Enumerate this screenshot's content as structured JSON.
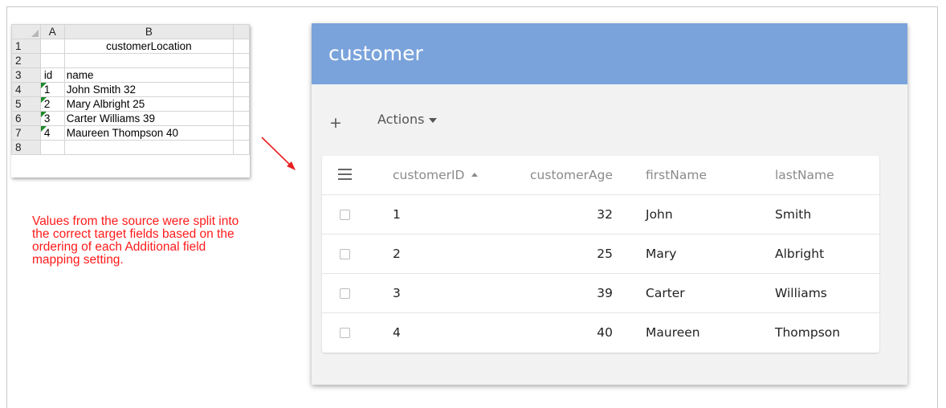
{
  "spreadsheet": {
    "column_headers": [
      "A",
      "B"
    ],
    "row_numbers": [
      "1",
      "2",
      "3",
      "4",
      "5",
      "6",
      "7",
      "8"
    ],
    "title_cell": "customerLocation",
    "header_id": "id",
    "header_name": "name",
    "rows": [
      {
        "id": "1",
        "name": "John Smith 32"
      },
      {
        "id": "2",
        "name": "Mary Albright 25"
      },
      {
        "id": "3",
        "name": "Carter Williams 39"
      },
      {
        "id": "4",
        "name": "Maureen Thompson 40"
      }
    ]
  },
  "annotation": {
    "text": "Values from the source were split into the correct target fields based on the ordering of each Additional field mapping setting.",
    "color": "#ff1a1a"
  },
  "panel": {
    "title": "customer",
    "header_color": "#7aa3db",
    "add_label": "+",
    "actions_label": "Actions",
    "columns": [
      "customerID",
      "customerAge",
      "firstName",
      "lastName"
    ],
    "sort_column": "customerID",
    "sort_direction": "ascending",
    "rows": [
      {
        "customerID": "1",
        "customerAge": "32",
        "firstName": "John",
        "lastName": "Smith"
      },
      {
        "customerID": "2",
        "customerAge": "25",
        "firstName": "Mary",
        "lastName": "Albright"
      },
      {
        "customerID": "3",
        "customerAge": "39",
        "firstName": "Carter",
        "lastName": "Williams"
      },
      {
        "customerID": "4",
        "customerAge": "40",
        "firstName": "Maureen",
        "lastName": "Thompson"
      }
    ]
  },
  "icons": [
    "menu-icon",
    "chevron-up-icon",
    "caret-down-icon",
    "arrow-icon"
  ]
}
